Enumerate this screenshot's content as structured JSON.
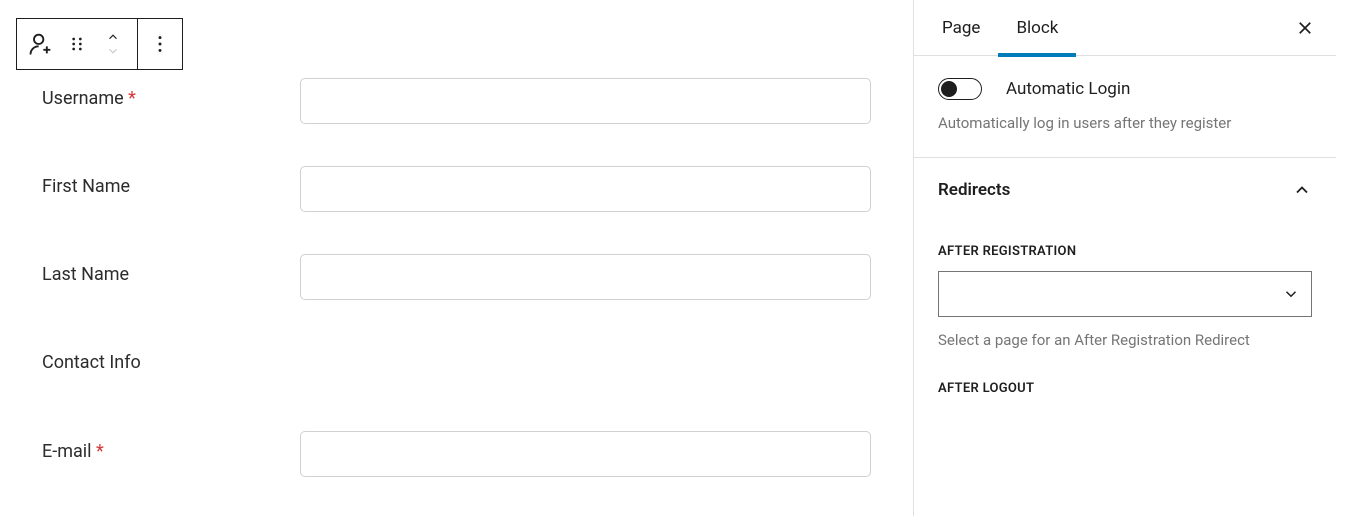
{
  "sidebar": {
    "tabs": {
      "page": "Page",
      "block": "Block"
    },
    "auto_login": {
      "label": "Automatic Login",
      "help": "Automatically log in users after they register"
    },
    "redirects": {
      "title": "Redirects",
      "after_registration": {
        "label": "After Registration",
        "help": "Select a page for an After Registration Redirect"
      },
      "after_logout": {
        "label": "After Logout"
      }
    }
  },
  "form": {
    "username": {
      "label": "Username",
      "required": "*"
    },
    "first_name": {
      "label": "First Name"
    },
    "last_name": {
      "label": "Last Name"
    },
    "contact_info": {
      "label": "Contact Info"
    },
    "email": {
      "label": "E-mail",
      "required": "*"
    }
  }
}
